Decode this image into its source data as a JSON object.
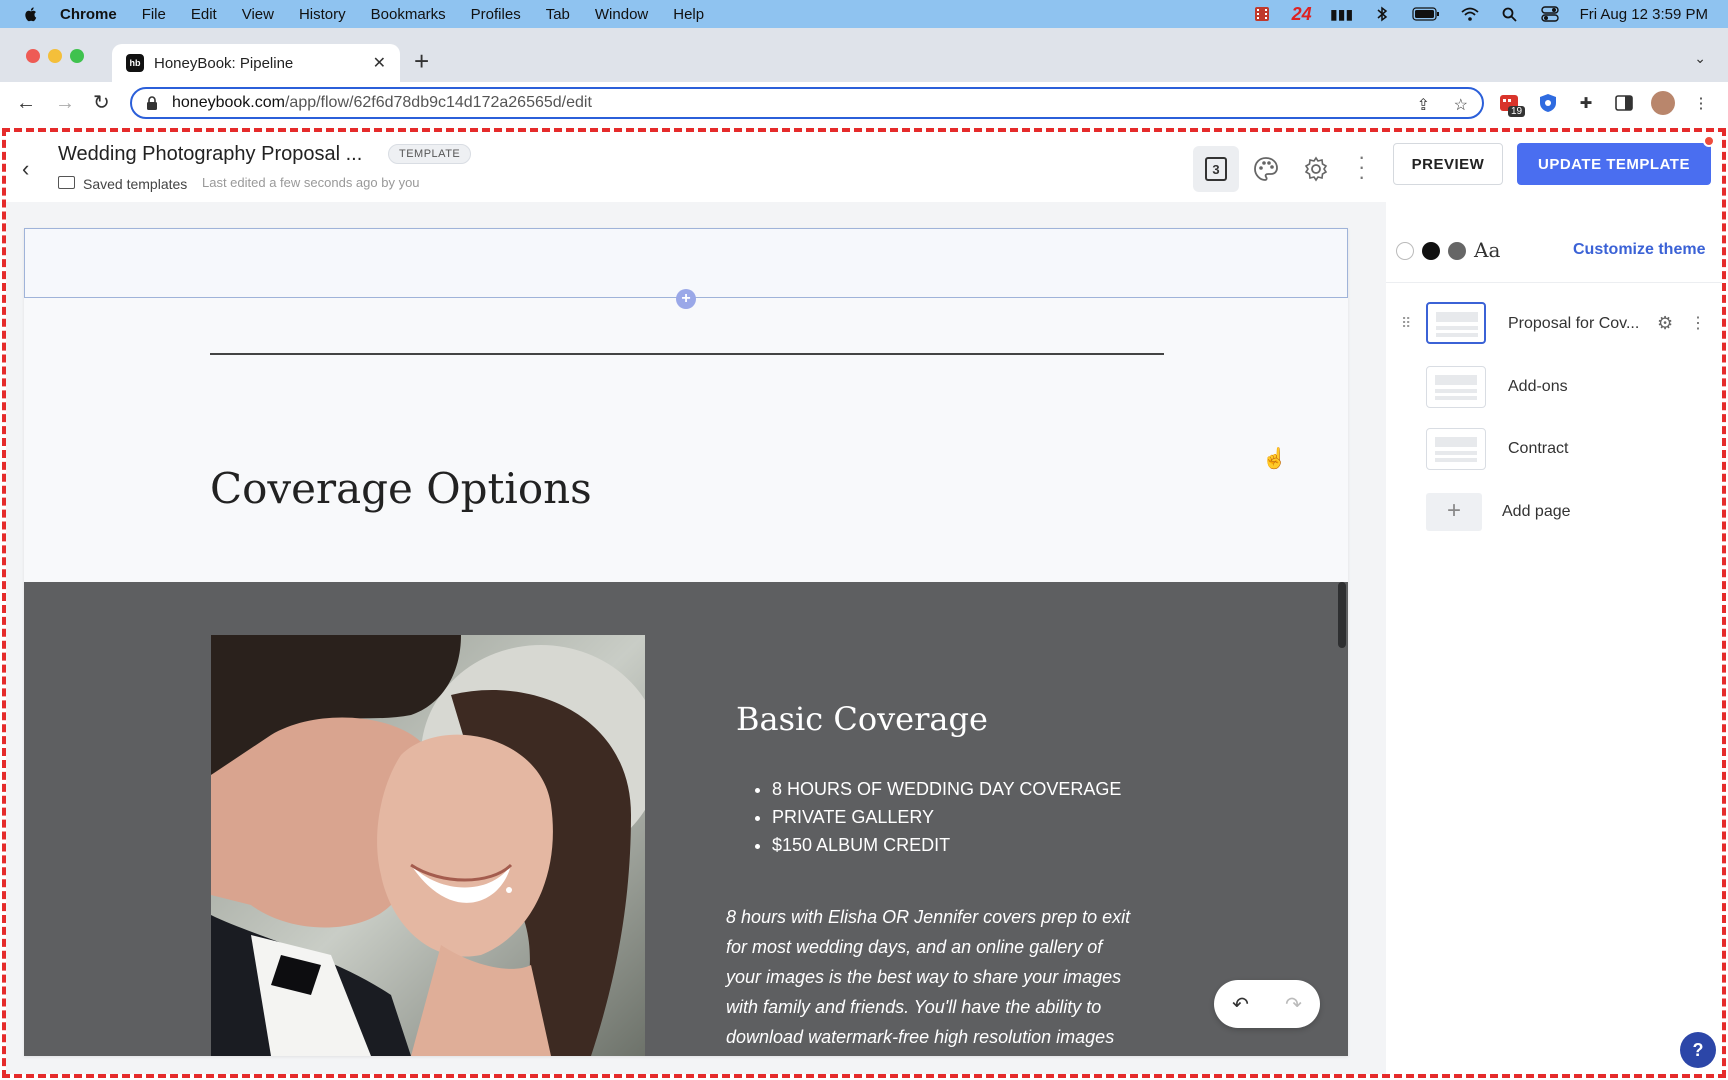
{
  "menubar": {
    "app_name": "Chrome",
    "items": [
      "File",
      "Edit",
      "View",
      "History",
      "Bookmarks",
      "Profiles",
      "Tab",
      "Window",
      "Help"
    ],
    "status_24": "24",
    "datetime": "Fri Aug 12  3:59 PM"
  },
  "browser": {
    "tab_title": "HoneyBook: Pipeline",
    "url_host": "honeybook.com",
    "url_path": "/app/flow/62f6d78db9c14d172a26565d/edit",
    "ext_badge": "19"
  },
  "header": {
    "title": "Wedding Photography Proposal ...",
    "badge": "TEMPLATE",
    "folder_label": "Saved templates",
    "last_edited": "Last edited a few seconds ago by you",
    "pages_count": "3",
    "preview_label": "PREVIEW",
    "update_label": "UPDATE TEMPLATE"
  },
  "canvas": {
    "section_title": "Coverage Options",
    "package_title": "Basic Coverage",
    "bullets": [
      "8 HOURS OF WEDDING DAY COVERAGE",
      "PRIVATE GALLERY",
      "$150 ALBUM CREDIT"
    ],
    "description_lines": [
      "8 hours with Elisha OR Jennifer covers prep to exit",
      "for most wedding days, and an online gallery of",
      "your images is the best way to share your images",
      "with family and friends. You'll have the ability to",
      "download watermark-free high resolution images"
    ]
  },
  "panel": {
    "font_sample": "Aa",
    "customize_label": "Customize theme",
    "pages": [
      {
        "label": "Proposal for Cov...",
        "active": true
      },
      {
        "label": "Add-ons",
        "active": false
      },
      {
        "label": "Contract",
        "active": false
      }
    ],
    "add_page_label": "Add page"
  },
  "help_label": "?",
  "colors": {
    "accent": "#4a6ef0",
    "link": "#3b62d6",
    "dark_section": "#5e5f61",
    "frame": "#e52b2b"
  }
}
